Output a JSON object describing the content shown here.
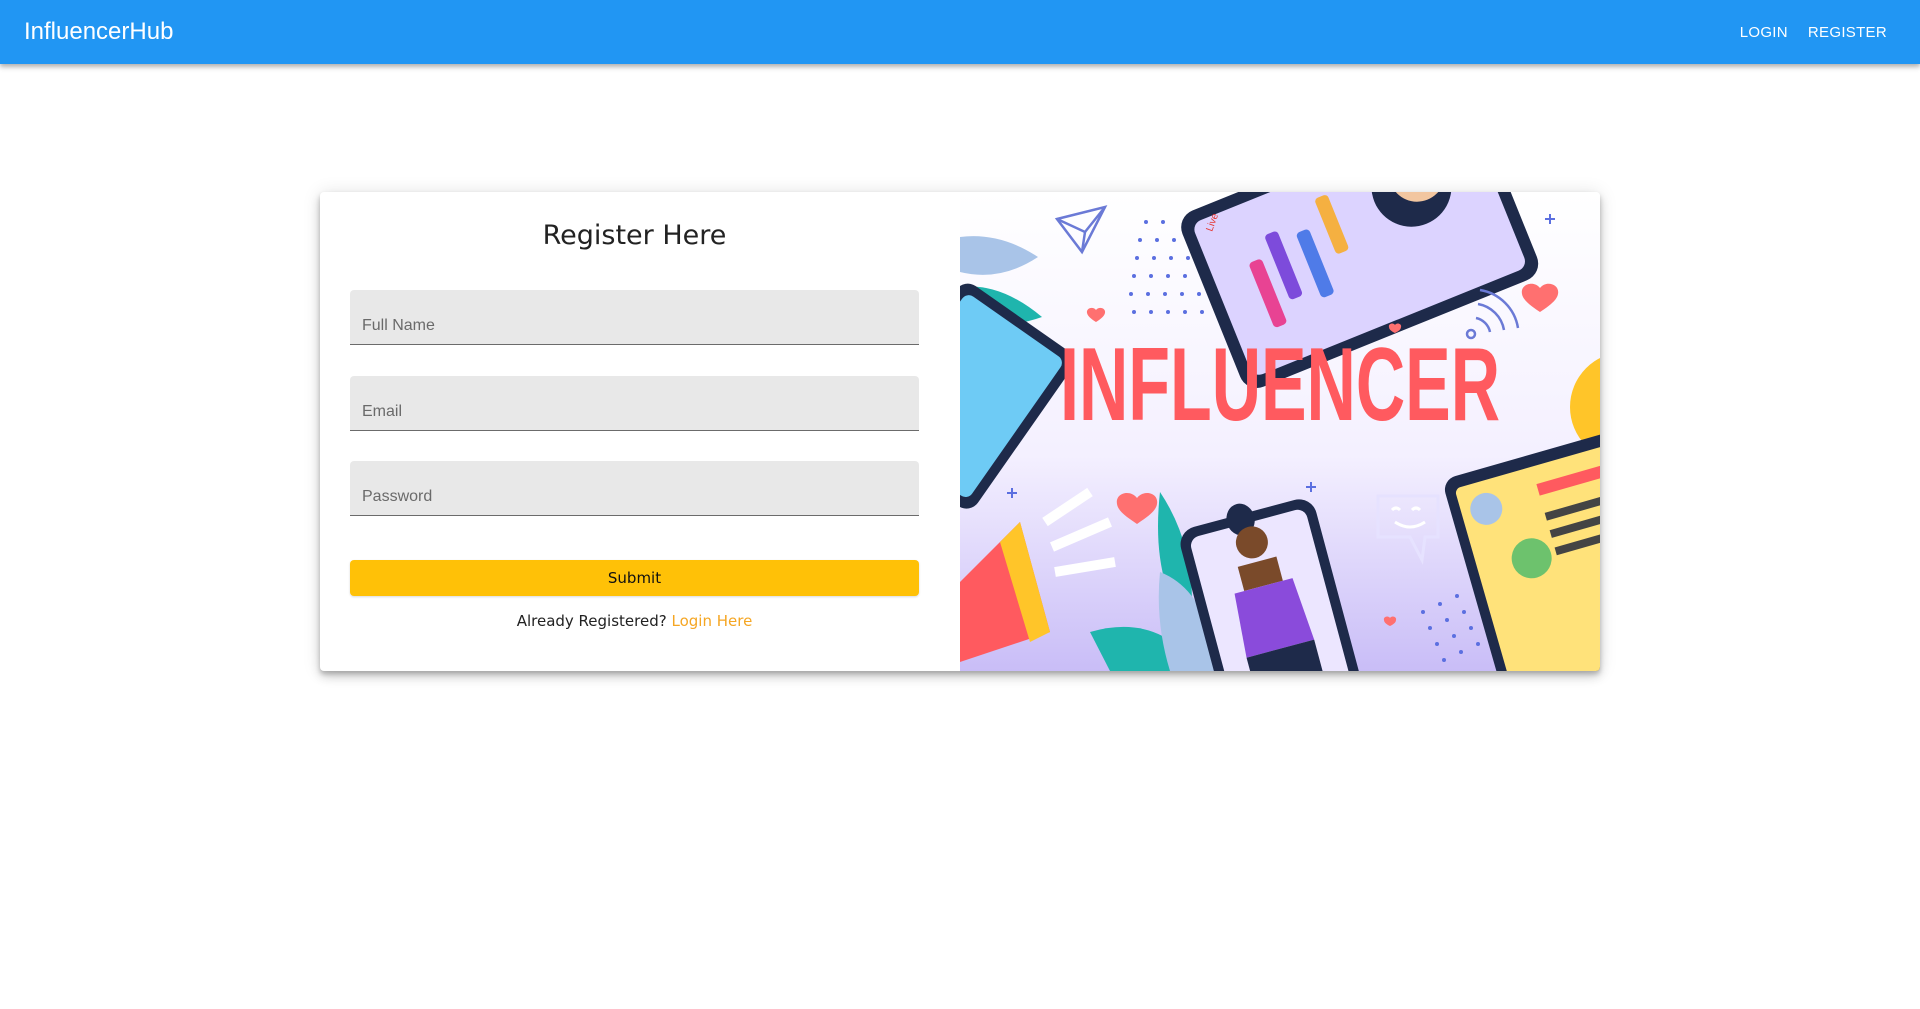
{
  "appbar": {
    "brand": "InfluencerHub",
    "login": "LOGIN",
    "register": "REGISTER"
  },
  "form": {
    "title": "Register Here",
    "full_name_placeholder": "Full Name",
    "email_placeholder": "Email",
    "password_placeholder": "Password",
    "submit_label": "Submit",
    "already_text": "Already Registered?",
    "login_link": "Login Here"
  },
  "illustration": {
    "headline": "INFLUENCER",
    "live_badge": "Live"
  },
  "colors": {
    "appbar": "#2196f3",
    "accent": "#ffc107",
    "link": "#f5a623",
    "headline": "#ff5a5f"
  },
  "icons": [
    "paper-plane-icon",
    "heart-icon",
    "megaphone-icon",
    "chat-bubble-icon",
    "wifi-signal-icon"
  ]
}
